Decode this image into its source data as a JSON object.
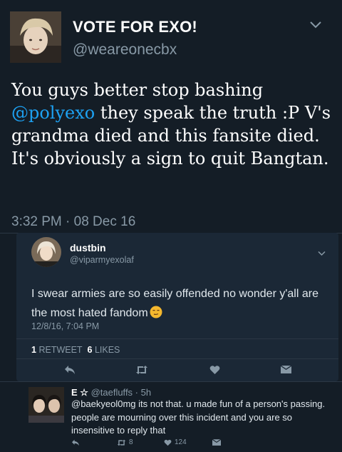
{
  "main_tweet": {
    "display_name": "VOTE FOR EXO!",
    "handle": "@weareonecbx",
    "text_before": "You guys better stop bashing ",
    "mention": "@polyexo",
    "text_after": " they speak the truth :P V's grandma died and this fansite died. It's obviously a sign to quit Bangtan.",
    "timestamp": "3:32 PM · 08 Dec 16"
  },
  "quoted_reply": {
    "display_name": "dustbin",
    "handle": "@viparmyexolaf",
    "text": "I swear armies are so easily offended no wonder y'all are the most hated fandom",
    "timestamp": "12/8/16, 7:04 PM",
    "retweet_count": "1",
    "retweet_label": "RETWEET",
    "like_count": "6",
    "like_label": "LIKES"
  },
  "nested_reply": {
    "display_name": "E ☆",
    "handle_time": "@taefluffs · 5h",
    "text": "@baekyeol0mg its not that. u made fun of a person's passing. people are mourning over this incident and you are so insensitive to reply that",
    "retweet_count": "8",
    "like_count": "124"
  },
  "colors": {
    "background": "#141d26",
    "card": "#1b2836",
    "accent": "#1da1f2",
    "secondary_text": "#8899a6"
  },
  "icons": [
    "chevron-down-icon",
    "reply-icon",
    "retweet-icon",
    "like-icon",
    "message-icon",
    "smiling-face-emoji"
  ]
}
